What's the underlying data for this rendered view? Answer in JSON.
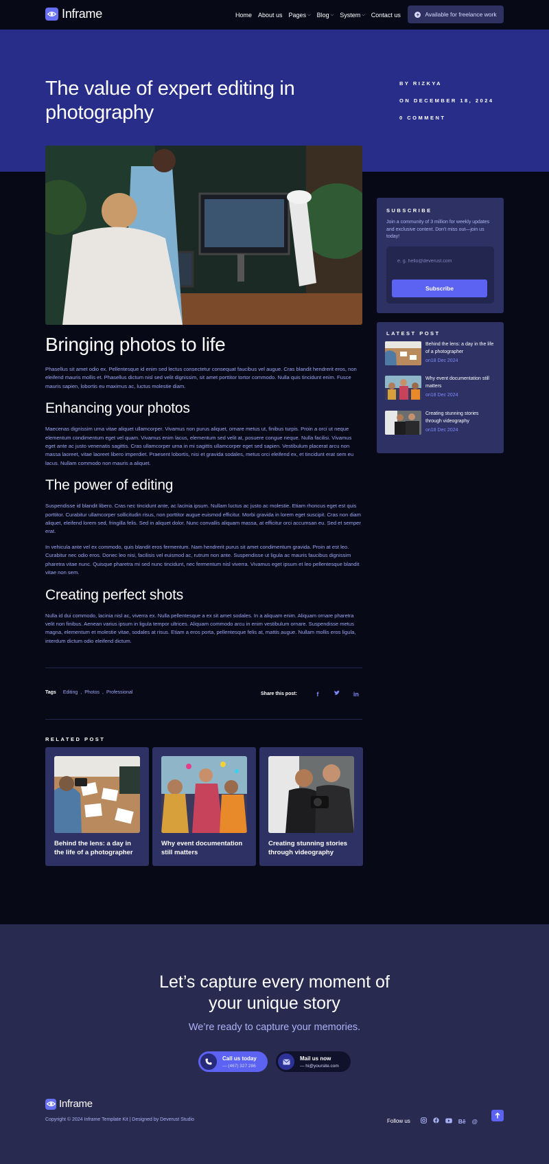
{
  "header": {
    "logo_text": "Inframe",
    "nav": [
      {
        "label": "Home",
        "dropdown": false
      },
      {
        "label": "About us",
        "dropdown": false
      },
      {
        "label": "Pages",
        "dropdown": true
      },
      {
        "label": "Blog",
        "dropdown": true
      },
      {
        "label": "System",
        "dropdown": true
      },
      {
        "label": "Contact us",
        "dropdown": false
      }
    ],
    "cta_label": "Available for freelance work"
  },
  "post": {
    "title": "The value of expert editing in photography",
    "meta": {
      "author": "BY RIZKYA",
      "date": "ON DECEMBER 18, 2024",
      "comments": "0 COMMENT"
    }
  },
  "article": {
    "h1": "Bringing photos to life",
    "p1": "Phasellus sit amet odio ex. Pellentesque id enim sed lectus consectetur consequat faucibus vel augue. Cras blandit hendrerit eros, non eleifend mauris mollis et. Phasellus dictum nisl sed velit dignissim, sit amet porttitor tortor commodo. Nulla quis tincidunt enim. Fusce mauris sapien, lobortis eu maximus ac, luctus molestie diam.",
    "h2a": "Enhancing your photos",
    "p2": "Maecenas dignissim urna vitae aliquet ullamcorper. Vivamus non purus aliquet, ornare metus ut, finibus turpis. Proin a orci ut neque elementum condimentum eget vel quam. Vivamus enim lacus, elementum sed velit at, posuere congue neque. Nulla facilisi. Vivamus eget ante ac justo venenatis sagittis. Cras ullamcorper urna in mi sagittis ullamcorper eget sed sapien. Vestibulum placerat arcu non massa laoreet, vitae laoreet libero imperdiet. Praesent lobortis, nisi et gravida sodales, metus orci eleifend ex, et tincidunt erat sem eu lacus. Nullam commodo non mauris a aliquet.",
    "h2b": "The power of editing",
    "p3": "Suspendisse id blandit libero. Cras nec tincidunt ante, ac lacinia ipsum. Nullam luctus ac justo ac molestie. Etiam rhoncus eget est quis porttitor. Curabitur ullamcorper sollicitudin risus, non porttitor augue euismod efficitur. Morbi gravida in lorem eget suscipit. Cras non diam aliquet, eleifend lorem sed, fringilla felis. Sed in aliquet dolor. Nunc convallis aliquam massa, at efficitur orci accumsan eu. Sed et semper erat.",
    "p4": "In vehicula ante vel ex commodo, quis blandit eros fermentum. Nam hendrerit purus sit amet condimentum gravida. Proin at est leo. Curabitur nec odio eros. Donec leo nisi, facilisis vel euismod ac, rutrum non ante. Suspendisse ut ligula ac mauris faucibus dignissim pharetra vitae nunc. Quisque pharetra mi sed nunc tincidunt, nec fermentum nisl viverra. Vivamus eget ipsum et leo pellentesque blandit vitae non sem.",
    "h2c": "Creating perfect shots",
    "p5": "Nulla id dui commodo, lacinia nisl ac, viverra ex. Nulla pellentesque a ex sit amet sodales. In a aliquam enim. Aliquam ornare pharetra velit non finibus. Aenean varius ipsum in ligula tempor ultrices. Aliquam commodo arcu in enim vestibulum ornare. Suspendisse metus magna, elementum et molestie vitae, sodales at risus. Etiam a eros porta, pellentesque felis at, mattis augue. Nullam mollis eros ligula, interdum dictum odio eleifend dictum."
  },
  "tags": {
    "label": "Tags",
    "items": [
      "Editing",
      "Photos",
      "Professional"
    ],
    "share_label": "Share this post:",
    "share_icons": [
      "facebook-icon",
      "twitter-icon",
      "linkedin-icon"
    ]
  },
  "related": {
    "title": "RELATED POST",
    "items": [
      {
        "title": "Behind the lens: a day in the life of a photographer"
      },
      {
        "title": "Why event documentation still matters"
      },
      {
        "title": "Creating stunning stories through videography"
      }
    ]
  },
  "subscribe": {
    "title": "SUBSCRIBE",
    "text": "Join a community of 3 million for weekly updates and exclusive content. Don't miss out—join us today!",
    "placeholder": "e. g. hello@deverust.com",
    "button": "Subscribe"
  },
  "latest": {
    "title": "LATEST POST",
    "items": [
      {
        "title": "Behind the lens: a day in the life of a photographer",
        "date": "on18 Dec 2024"
      },
      {
        "title": "Why event documentation still matters",
        "date": "on18 Dec 2024"
      },
      {
        "title": "Creating stunning stories through videography",
        "date": "on18 Dec 2024"
      }
    ]
  },
  "cta": {
    "heading_line1": "Let’s capture every moment of",
    "heading_line2": "your unique story",
    "subheading": "We’re ready to capture your memories.",
    "call_label": "Call us today",
    "call_value": "— (467) 327 286",
    "mail_label": "Mail us now",
    "mail_value": "— hi@yoursite.com"
  },
  "footer": {
    "logo_text": "Inframe",
    "copyright": "Copyright © 2024 Inframe Template Kit | Designed by Deverust Studio",
    "follow_label": "Follow us",
    "social": [
      "instagram-icon",
      "facebook-icon",
      "youtube-icon",
      "behance-icon",
      "threads-icon"
    ]
  },
  "colors": {
    "background": "#080916",
    "hero": "#272d89",
    "card": "#2d3163",
    "accent": "#5c63f3",
    "body_text": "#9aa6f5"
  }
}
